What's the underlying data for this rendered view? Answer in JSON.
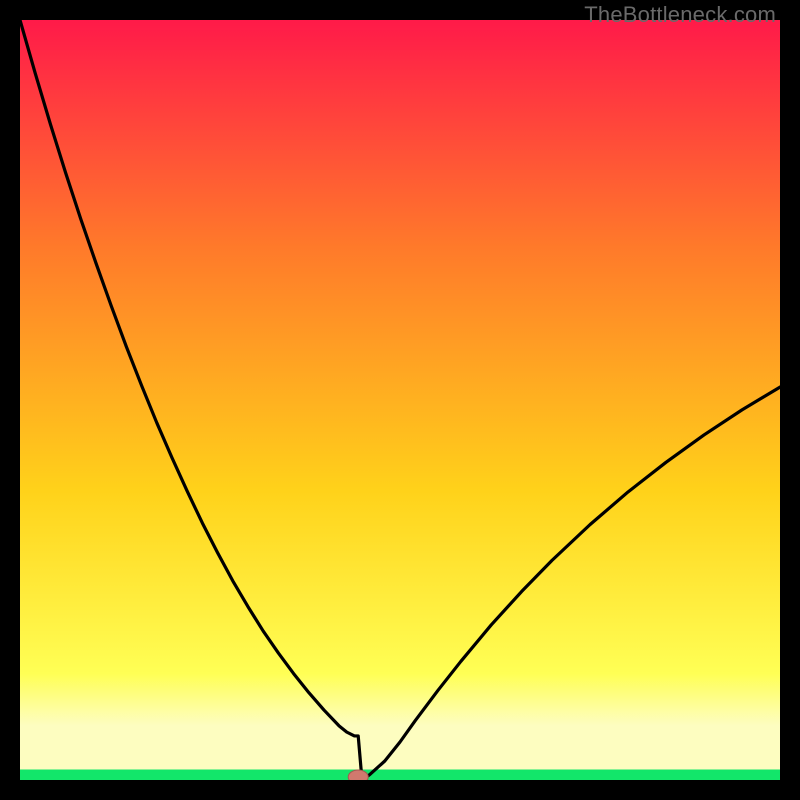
{
  "watermark": "TheBottleneck.com",
  "colors": {
    "background": "#000000",
    "gradient_top": "#ff1a49",
    "gradient_mid_upper": "#ff7a2a",
    "gradient_mid": "#ffd21a",
    "gradient_mid_lower": "#ffff55",
    "gradient_band": "#fdfdc0",
    "gradient_green": "#12e66a",
    "curve": "#000000",
    "marker_fill": "#d0796e",
    "marker_stroke": "#a05a50"
  },
  "chart_data": {
    "type": "line",
    "title": "",
    "xlabel": "",
    "ylabel": "",
    "xlim": [
      0,
      100
    ],
    "ylim": [
      0,
      100
    ],
    "x": [
      0,
      2,
      4,
      6,
      8,
      10,
      12,
      14,
      16,
      18,
      20,
      22,
      24,
      26,
      28,
      30,
      32,
      34,
      36,
      38,
      40,
      42,
      43,
      44,
      44.5,
      45,
      46,
      48,
      50,
      52,
      55,
      58,
      62,
      66,
      70,
      75,
      80,
      85,
      90,
      95,
      100
    ],
    "values": [
      100,
      93,
      86.3,
      79.9,
      73.8,
      68,
      62.4,
      57,
      51.9,
      47,
      42.4,
      38,
      33.8,
      29.9,
      26.2,
      22.8,
      19.6,
      16.7,
      14,
      11.5,
      9.2,
      7.1,
      6.3,
      5.8,
      5.8,
      0,
      0.7,
      2.5,
      5,
      7.8,
      11.8,
      15.6,
      20.4,
      24.8,
      28.9,
      33.6,
      37.9,
      41.8,
      45.4,
      48.7,
      51.7
    ],
    "marker": {
      "x": 44.5,
      "y": 0
    },
    "green_band_ymax": 1.4,
    "pale_band_ymax": 7.2
  }
}
